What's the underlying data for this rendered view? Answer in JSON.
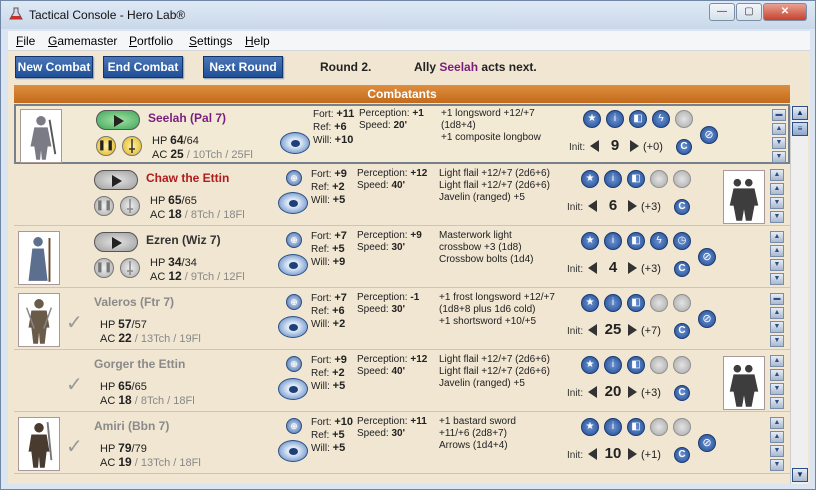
{
  "window": {
    "title": "Tactical Console - Hero Lab®",
    "minimize": "—",
    "maximize": "▢",
    "close": "✕"
  },
  "menu": [
    {
      "label": "File",
      "accel": "F",
      "rest": "ile"
    },
    {
      "label": "Gamemaster",
      "accel": "G",
      "rest": "amemaster"
    },
    {
      "label": "Portfolio",
      "accel": "P",
      "rest": "ortfolio"
    },
    {
      "label": "Settings",
      "accel": "S",
      "rest": "ettings"
    },
    {
      "label": "Help",
      "accel": "H",
      "rest": "elp"
    }
  ],
  "toolbar": {
    "new_combat": "New Combat",
    "end_combat": "End Combat",
    "next_round": "Next Round"
  },
  "status": {
    "round": "Round 2.",
    "next_prefix": "Ally",
    "next_name": "Seelah",
    "next_suffix": "acts next."
  },
  "header": "Combatants",
  "colors": {
    "active_name": "#7a1e7d",
    "enemy_name": "#b01c1c",
    "ally_name": "#333333",
    "done_name": "#8a8a8a",
    "header": "#d17a2b"
  },
  "combatants": [
    {
      "name": "Seelah (Pal 7)",
      "hp": "64",
      "hp_max": "/64",
      "ac": "25",
      "ac_extra": "/ 10Tch / 25Fl",
      "fort": "+11",
      "ref": "+6",
      "will": "+10",
      "perception": "+1",
      "speed": "20'",
      "attacks": [
        "+1 longsword +12/+7",
        "(1d8+4)",
        "+1 composite longbow"
      ],
      "init": "9",
      "init_mod": "(+0)"
    },
    {
      "name": "Chaw the Ettin",
      "hp": "65",
      "hp_max": "/65",
      "ac": "18",
      "ac_extra": "/ 8Tch / 18Fl",
      "fort": "+9",
      "ref": "+2",
      "will": "+5",
      "perception": "+12",
      "speed": "40'",
      "attacks": [
        "Light flail +12/+7 (2d6+6)",
        "Light flail +12/+7 (2d6+6)",
        "Javelin (ranged) +5"
      ],
      "init": "6",
      "init_mod": "(+3)"
    },
    {
      "name": "Ezren (Wiz 7)",
      "hp": "34",
      "hp_max": "/34",
      "ac": "12",
      "ac_extra": "/ 9Tch / 12Fl",
      "fort": "+7",
      "ref": "+5",
      "will": "+9",
      "perception": "+9",
      "speed": "30'",
      "attacks": [
        "Masterwork light",
        "crossbow +3 (1d8)",
        "Crossbow bolts (1d4)"
      ],
      "init": "4",
      "init_mod": "(+3)"
    },
    {
      "name": "Valeros (Ftr 7)",
      "hp": "57",
      "hp_max": "/57",
      "ac": "22",
      "ac_extra": "/ 13Tch / 19Fl",
      "fort": "+7",
      "ref": "+6",
      "will": "+2",
      "perception": "-1",
      "speed": "30'",
      "attacks": [
        "+1 frost longsword +12/+7",
        "(1d8+8 plus 1d6 cold)",
        "+1 shortsword +10/+5"
      ],
      "init": "25",
      "init_mod": "(+7)"
    },
    {
      "name": "Gorger the Ettin",
      "hp": "65",
      "hp_max": "/65",
      "ac": "18",
      "ac_extra": "/ 8Tch / 18Fl",
      "fort": "+9",
      "ref": "+2",
      "will": "+5",
      "perception": "+12",
      "speed": "40'",
      "attacks": [
        "Light flail +12/+7 (2d6+6)",
        "Light flail +12/+7 (2d6+6)",
        "Javelin (ranged) +5"
      ],
      "init": "20",
      "init_mod": "(+3)"
    },
    {
      "name": "Amiri (Bbn 7)",
      "hp": "79",
      "hp_max": "/79",
      "ac": "19",
      "ac_extra": "/ 13Tch / 18Fl",
      "fort": "+10",
      "ref": "+5",
      "will": "+5",
      "perception": "+11",
      "speed": "30'",
      "attacks": [
        "+1 bastard sword",
        "+11/+6 (2d8+7)",
        "Arrows  (1d4+4)"
      ],
      "init": "10",
      "init_mod": "(+1)"
    }
  ],
  "labels": {
    "fort": "Fort:",
    "ref": "Ref:",
    "will": "Will:",
    "perception": "Perception:",
    "speed": "Speed:",
    "hp": "HP",
    "ac": "AC",
    "init": "Init:",
    "c": "C",
    "pause": "❚❚",
    "check": "✓"
  }
}
